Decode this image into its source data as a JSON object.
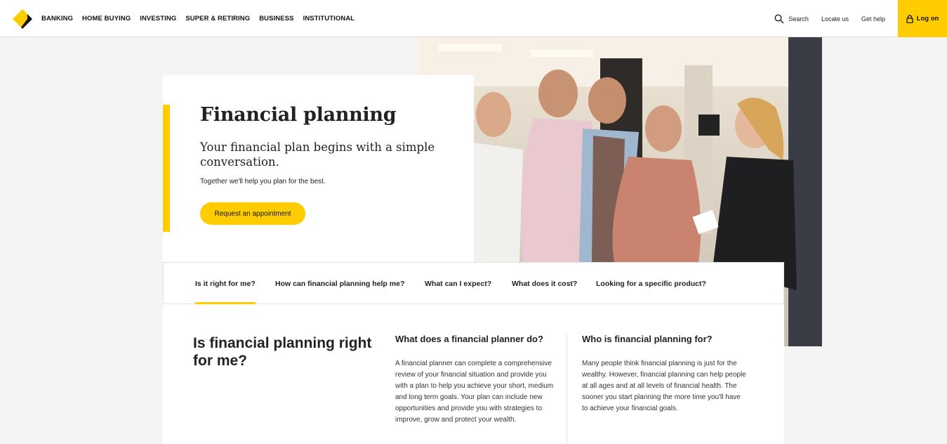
{
  "nav": {
    "links": [
      "BANKING",
      "HOME BUYING",
      "INVESTING",
      "SUPER & RETIRING",
      "BUSINESS",
      "INSTITUTIONAL"
    ],
    "search_label": "Search",
    "locate_label": "Locate us",
    "help_label": "Get help",
    "logon_label": "Log on"
  },
  "hero": {
    "title": "Financial planning",
    "subtitle": "Your financial plan begins with a simple conversation.",
    "tagline": "Together we'll help you plan for the best.",
    "cta_label": "Request an appointment"
  },
  "tabs": [
    "Is it right for me?",
    "How can financial planning help me?",
    "What can I expect?",
    "What does it cost?",
    "Looking for a specific product?"
  ],
  "section": {
    "title": "Is financial planning right for me?",
    "col1_heading": "What does a financial planner do?",
    "col1_text": "A financial planner can complete a comprehensive review of your financial situation and provide you with a plan to help you achieve your short, medium and long term goals. Your plan can include new opportunities and provide you with strategies to improve, grow and protect your wealth.",
    "col2_heading": "Who is financial planning for?",
    "col2_text": "Many people think financial planning is just for the wealthy. However, financial planning can help people at all ages and at all levels of financial health. The sooner you start planning the more time you'll have to achieve your financial goals."
  },
  "colors": {
    "brand_yellow": "#ffcc00",
    "text": "#222222"
  },
  "icons": [
    "brand-logo-icon",
    "search-icon",
    "lock-icon"
  ]
}
